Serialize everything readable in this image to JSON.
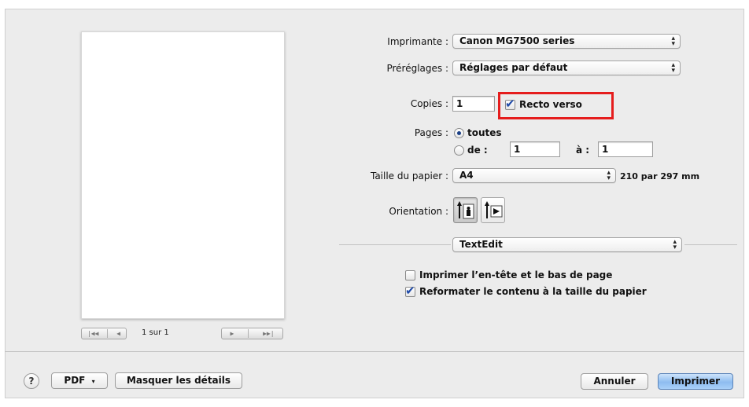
{
  "preview": {
    "page_count": "1 sur 1",
    "nav_first_icon": "first-page-icon",
    "nav_prev_icon": "previous-page-icon",
    "nav_next_icon": "next-page-icon",
    "nav_last_icon": "last-page-icon"
  },
  "printer": {
    "label": "Imprimante :",
    "value": "Canon MG7500 series"
  },
  "presets": {
    "label": "Préréglages :",
    "value": "Réglages par défaut"
  },
  "copies": {
    "label": "Copies :",
    "value": "1",
    "duplex_label": "Recto verso",
    "duplex_checked": true
  },
  "pages": {
    "label": "Pages :",
    "all_label": "toutes",
    "all_selected": true,
    "range_from_label": "de :",
    "range_from_value": "1",
    "range_to_label": "à :",
    "range_to_value": "1"
  },
  "paper_size": {
    "label": "Taille du papier :",
    "value": "A4",
    "dimensions": "210 par 297 mm"
  },
  "orientation": {
    "label": "Orientation :",
    "selected": "portrait"
  },
  "app_section": {
    "value": "TextEdit"
  },
  "options": {
    "header_footer_label": "Imprimer l’en-tête et le bas de page",
    "header_footer_checked": false,
    "rewrap_label": "Reformater le contenu à la taille du papier",
    "rewrap_checked": true
  },
  "footer": {
    "help_label": "?",
    "pdf_label": "PDF",
    "hide_details_label": "Masquer les détails",
    "cancel_label": "Annuler",
    "print_label": "Imprimer"
  },
  "colors": {
    "highlight": "#e51d1d",
    "accent": "#8ebcf0",
    "checkmark": "#1f4aa8"
  }
}
